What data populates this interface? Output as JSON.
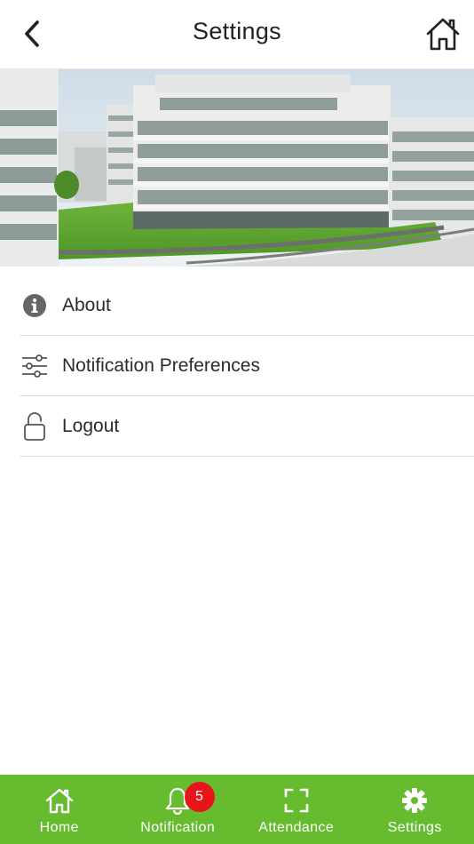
{
  "header": {
    "title": "Settings",
    "back_icon": "chevron-left-icon",
    "home_icon": "home-icon"
  },
  "banner": {
    "icon": "campus-photo"
  },
  "menu": {
    "items": [
      {
        "label": "About",
        "icon": "info-icon"
      },
      {
        "label": "Notification Preferences",
        "icon": "sliders-icon"
      },
      {
        "label": "Logout",
        "icon": "unlock-icon"
      }
    ]
  },
  "tabbar": {
    "background": "#66bb2e",
    "tabs": [
      {
        "label": "Home",
        "icon": "home-icon"
      },
      {
        "label": "Notification",
        "icon": "bell-icon",
        "badge": "5"
      },
      {
        "label": "Attendance",
        "icon": "scan-icon"
      },
      {
        "label": "Settings",
        "icon": "gear-icon",
        "active": true
      }
    ]
  },
  "colors": {
    "accent": "#66bb2e",
    "badge": "#e8141b"
  }
}
